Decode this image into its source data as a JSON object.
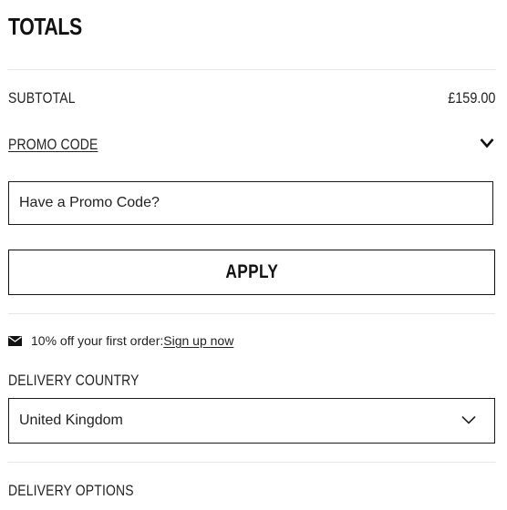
{
  "totals": {
    "title": "TOTALS",
    "subtotal_label": "SUBTOTAL",
    "subtotal_value": "£159.00"
  },
  "promo": {
    "label": "PROMO CODE",
    "input_placeholder": "Have a Promo Code?",
    "apply_label": "APPLY",
    "offer_text": "10% off your first order: ",
    "signup_link": "Sign up now"
  },
  "delivery": {
    "country_label": "DELIVERY COUNTRY",
    "country_selected": "United Kingdom",
    "options_label": "DELIVERY OPTIONS"
  },
  "icons": {
    "promo_toggle": "chevron-down-icon",
    "offer": "envelope-icon",
    "country_select": "chevron-down-icon"
  }
}
